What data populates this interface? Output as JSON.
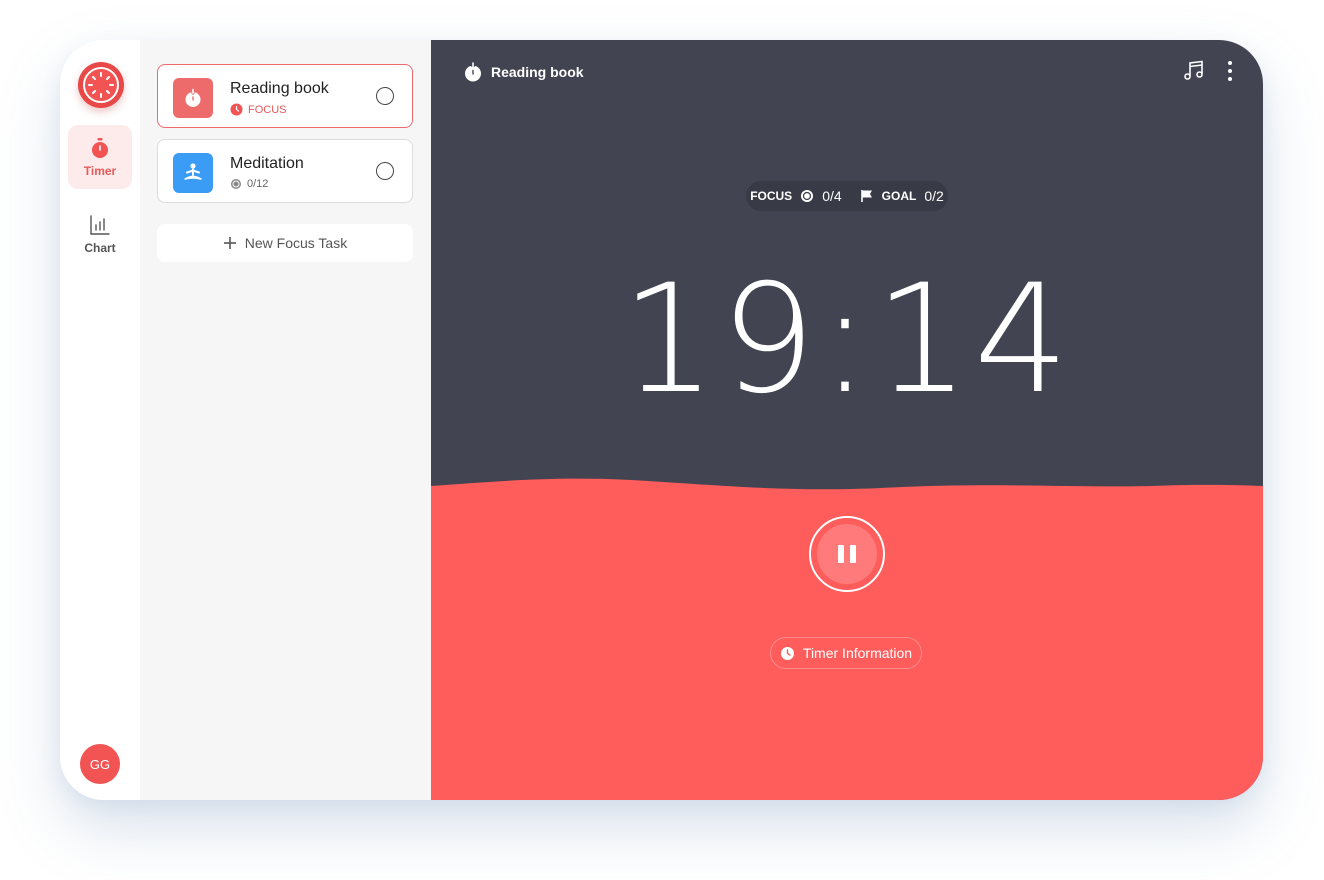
{
  "app": {
    "accent_color": "#f25454",
    "dark_color": "#424452"
  },
  "rail": {
    "logo_icon": "tomato-timer-logo-icon",
    "items": [
      {
        "label": "Timer",
        "icon": "stopwatch-icon",
        "active": true
      },
      {
        "label": "Chart",
        "icon": "bar-chart-icon",
        "active": false
      }
    ],
    "avatar_initials": "GG"
  },
  "tasks": {
    "items": [
      {
        "name": "Reading book",
        "meta": "FOCUS",
        "icon": "tomato-icon",
        "tile_color": "#ee6b6b",
        "meta_color": "#e55a5a",
        "active": true
      },
      {
        "name": "Meditation",
        "meta": "0/12",
        "icon": "meditation-icon",
        "tile_color": "#3b9cf5",
        "meta_color": "#666666",
        "active": false
      }
    ],
    "new_task_label": "New Focus Task"
  },
  "timer": {
    "current_task": "Reading book",
    "focus_label": "FOCUS",
    "focus_count": "0/4",
    "goal_label": "GOAL",
    "goal_count": "0/2",
    "time": "19:14",
    "info_label": "Timer Information",
    "progress_color": "#ff5c5c"
  }
}
